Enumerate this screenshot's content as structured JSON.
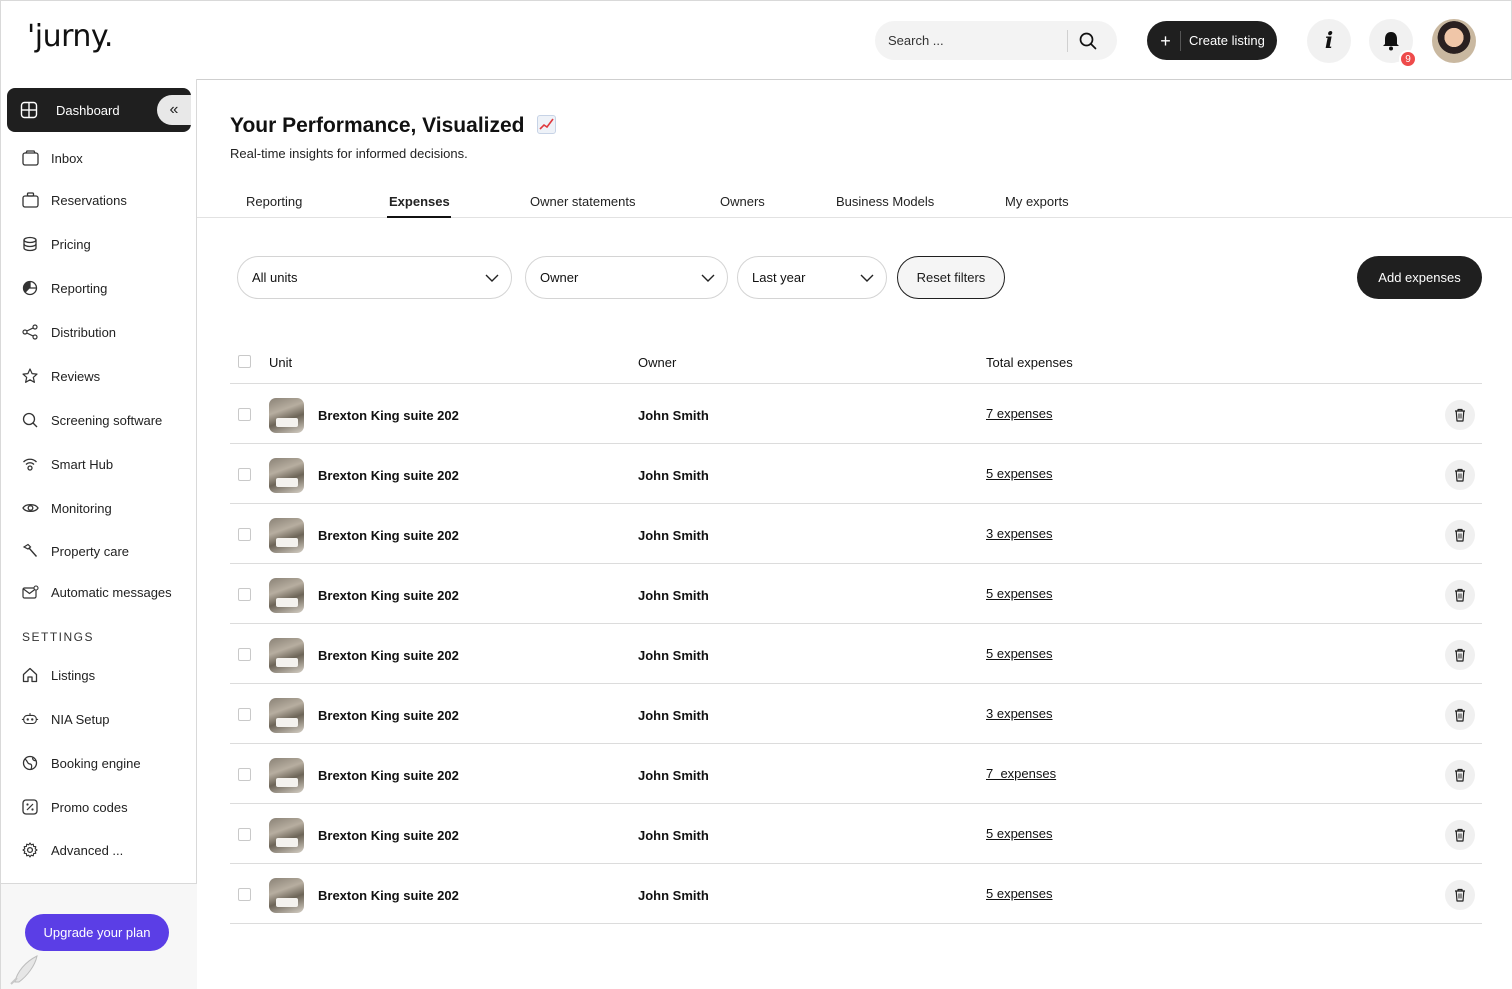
{
  "app": {
    "logo": "'jurny."
  },
  "header": {
    "search_placeholder": "Search ...",
    "create_listing_label": "Create listing",
    "notification_count": "9"
  },
  "sidebar": {
    "active_item": "Dashboard",
    "items": [
      {
        "label": "Inbox",
        "icon": "inbox-icon"
      },
      {
        "label": "Reservations",
        "icon": "briefcase-icon"
      },
      {
        "label": "Pricing",
        "icon": "coins-icon"
      },
      {
        "label": "Reporting",
        "icon": "pie-chart-icon"
      },
      {
        "label": "Distribution",
        "icon": "share-icon"
      },
      {
        "label": "Reviews",
        "icon": "star-icon"
      },
      {
        "label": "Screening software",
        "icon": "search-icon"
      },
      {
        "label": "Smart Hub",
        "icon": "wifi-icon"
      },
      {
        "label": "Monitoring",
        "icon": "eye-icon"
      },
      {
        "label": "Property care",
        "icon": "hammer-icon"
      },
      {
        "label": "Automatic messages",
        "icon": "mail-icon"
      }
    ],
    "settings_heading": "SETTINGS",
    "settings_items": [
      {
        "label": "Listings",
        "icon": "home-icon"
      },
      {
        "label": "NIA Setup",
        "icon": "robot-icon"
      },
      {
        "label": "Booking engine",
        "icon": "globe-icon"
      },
      {
        "label": "Promo codes",
        "icon": "percent-icon"
      },
      {
        "label": "Advanced ...",
        "icon": "gear-icon"
      }
    ],
    "upgrade_label": "Upgrade your plan"
  },
  "main": {
    "title": "Your Performance, Visualized",
    "subtitle": "Real-time insights for informed decisions.",
    "tabs": [
      "Reporting",
      "Expenses",
      "Owner statements",
      "Owners",
      "Business Models",
      "My exports"
    ],
    "active_tab": "Expenses",
    "filters": {
      "units": "All units",
      "owner": "Owner",
      "period": "Last year",
      "reset_label": "Reset filters",
      "add_label": "Add expenses"
    },
    "table": {
      "columns": [
        "Unit",
        "Owner",
        "Total expenses"
      ],
      "rows": [
        {
          "unit": "Brexton King suite 202",
          "owner": "John Smith",
          "expenses": "7 expenses"
        },
        {
          "unit": "Brexton King suite 202",
          "owner": "John Smith",
          "expenses": "5 expenses"
        },
        {
          "unit": "Brexton King suite 202",
          "owner": "John Smith",
          "expenses": "3 expenses"
        },
        {
          "unit": "Brexton King suite 202",
          "owner": "John Smith",
          "expenses": "5 expenses"
        },
        {
          "unit": "Brexton King suite 202",
          "owner": "John Smith",
          "expenses": "5 expenses"
        },
        {
          "unit": "Brexton King suite 202",
          "owner": "John Smith",
          "expenses": "3 expenses"
        },
        {
          "unit": "Brexton King suite 202",
          "owner": "John Smith",
          "expenses": "7  expenses"
        },
        {
          "unit": "Brexton King suite 202",
          "owner": "John Smith",
          "expenses": "5 expenses"
        },
        {
          "unit": "Brexton King suite 202",
          "owner": "John Smith",
          "expenses": "5 expenses"
        }
      ]
    }
  },
  "colors": {
    "primary_dark": "#1f1f1f",
    "upgrade_purple": "#5b3ee6",
    "badge_red": "#ee4b4b"
  }
}
